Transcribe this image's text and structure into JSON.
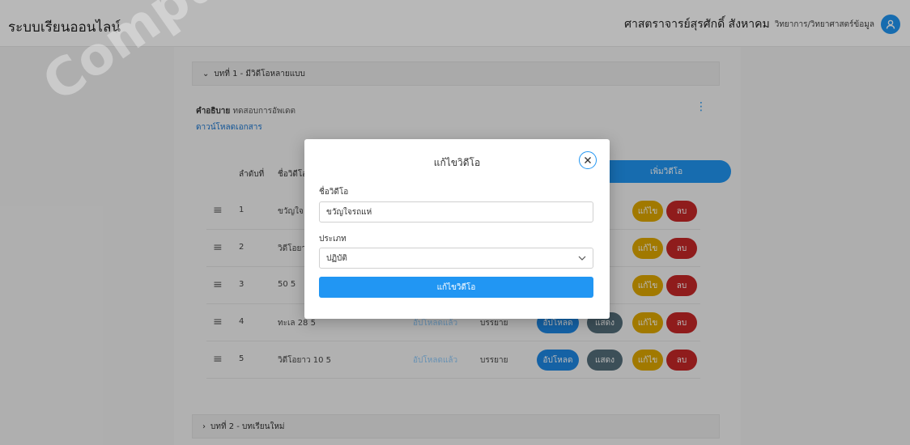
{
  "header": {
    "app_title": "ระบบเรียนออนไลน์",
    "user_name": "ศาสตราจารย์สุรศักดิ์ สังหาคม",
    "user_dept": "วิทยาการ/วิทยาศาสตร์ข้อมูล",
    "avatar_icon": "user-icon"
  },
  "chapters": [
    {
      "label": "บทที่ 1 - มีวิดีโอหลายแบบ",
      "expanded": true
    },
    {
      "label": "บทที่ 2 - บทเรียนใหม่",
      "expanded": false
    }
  ],
  "chapter1": {
    "desc_label": "คำอธิบาย",
    "desc_value": "ทดสอบการอัพเดต",
    "download_link": "ดาวน์โหลดเอกสาร"
  },
  "table": {
    "col_order": "ลำดับที่",
    "col_name": "ชื่อวิดีโอ",
    "add_button": "เพิ่มวิดีโอ",
    "rows": [
      {
        "order": "1",
        "name": "ขวัญใจ",
        "status": "",
        "type": ""
      },
      {
        "order": "2",
        "name": "วิดีโอยา",
        "status": "",
        "type": ""
      },
      {
        "order": "3",
        "name": "50 5",
        "status": "",
        "type": ""
      },
      {
        "order": "4",
        "name": "ทะเล 28 5",
        "status": "อัปโหลดแล้ว",
        "type": "บรรยาย"
      },
      {
        "order": "5",
        "name": "วิดีโอยาว 10 5",
        "status": "อัปโหลดแล้ว",
        "type": "บรรยาย"
      }
    ],
    "btn_upload": "อัปโหลด",
    "btn_show": "แสดง",
    "btn_edit": "แก้ไข",
    "btn_delete": "ลบ"
  },
  "modal": {
    "title": "แก้ไขวิดีโอ",
    "name_label": "ชื่อวิดีโอ",
    "name_value": "ขวัญใจรถแห่",
    "type_label": "ประเภท",
    "type_value": "ปฏิบัติ",
    "submit_label": "แก้ไขวิดีโอ"
  },
  "watermark": "Computer Science, Faculty of Informatics, M"
}
